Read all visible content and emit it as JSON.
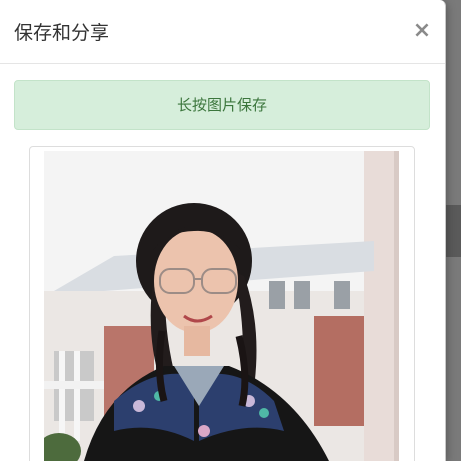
{
  "modal": {
    "title": "保存和分享",
    "close_label": "×"
  },
  "alert": {
    "text": "长按图片保存"
  },
  "photo": {
    "description_icon": "portrait-photo"
  },
  "colors": {
    "alert_bg": "#d6eedb",
    "alert_text": "#3c763d",
    "title_text": "#333333"
  }
}
